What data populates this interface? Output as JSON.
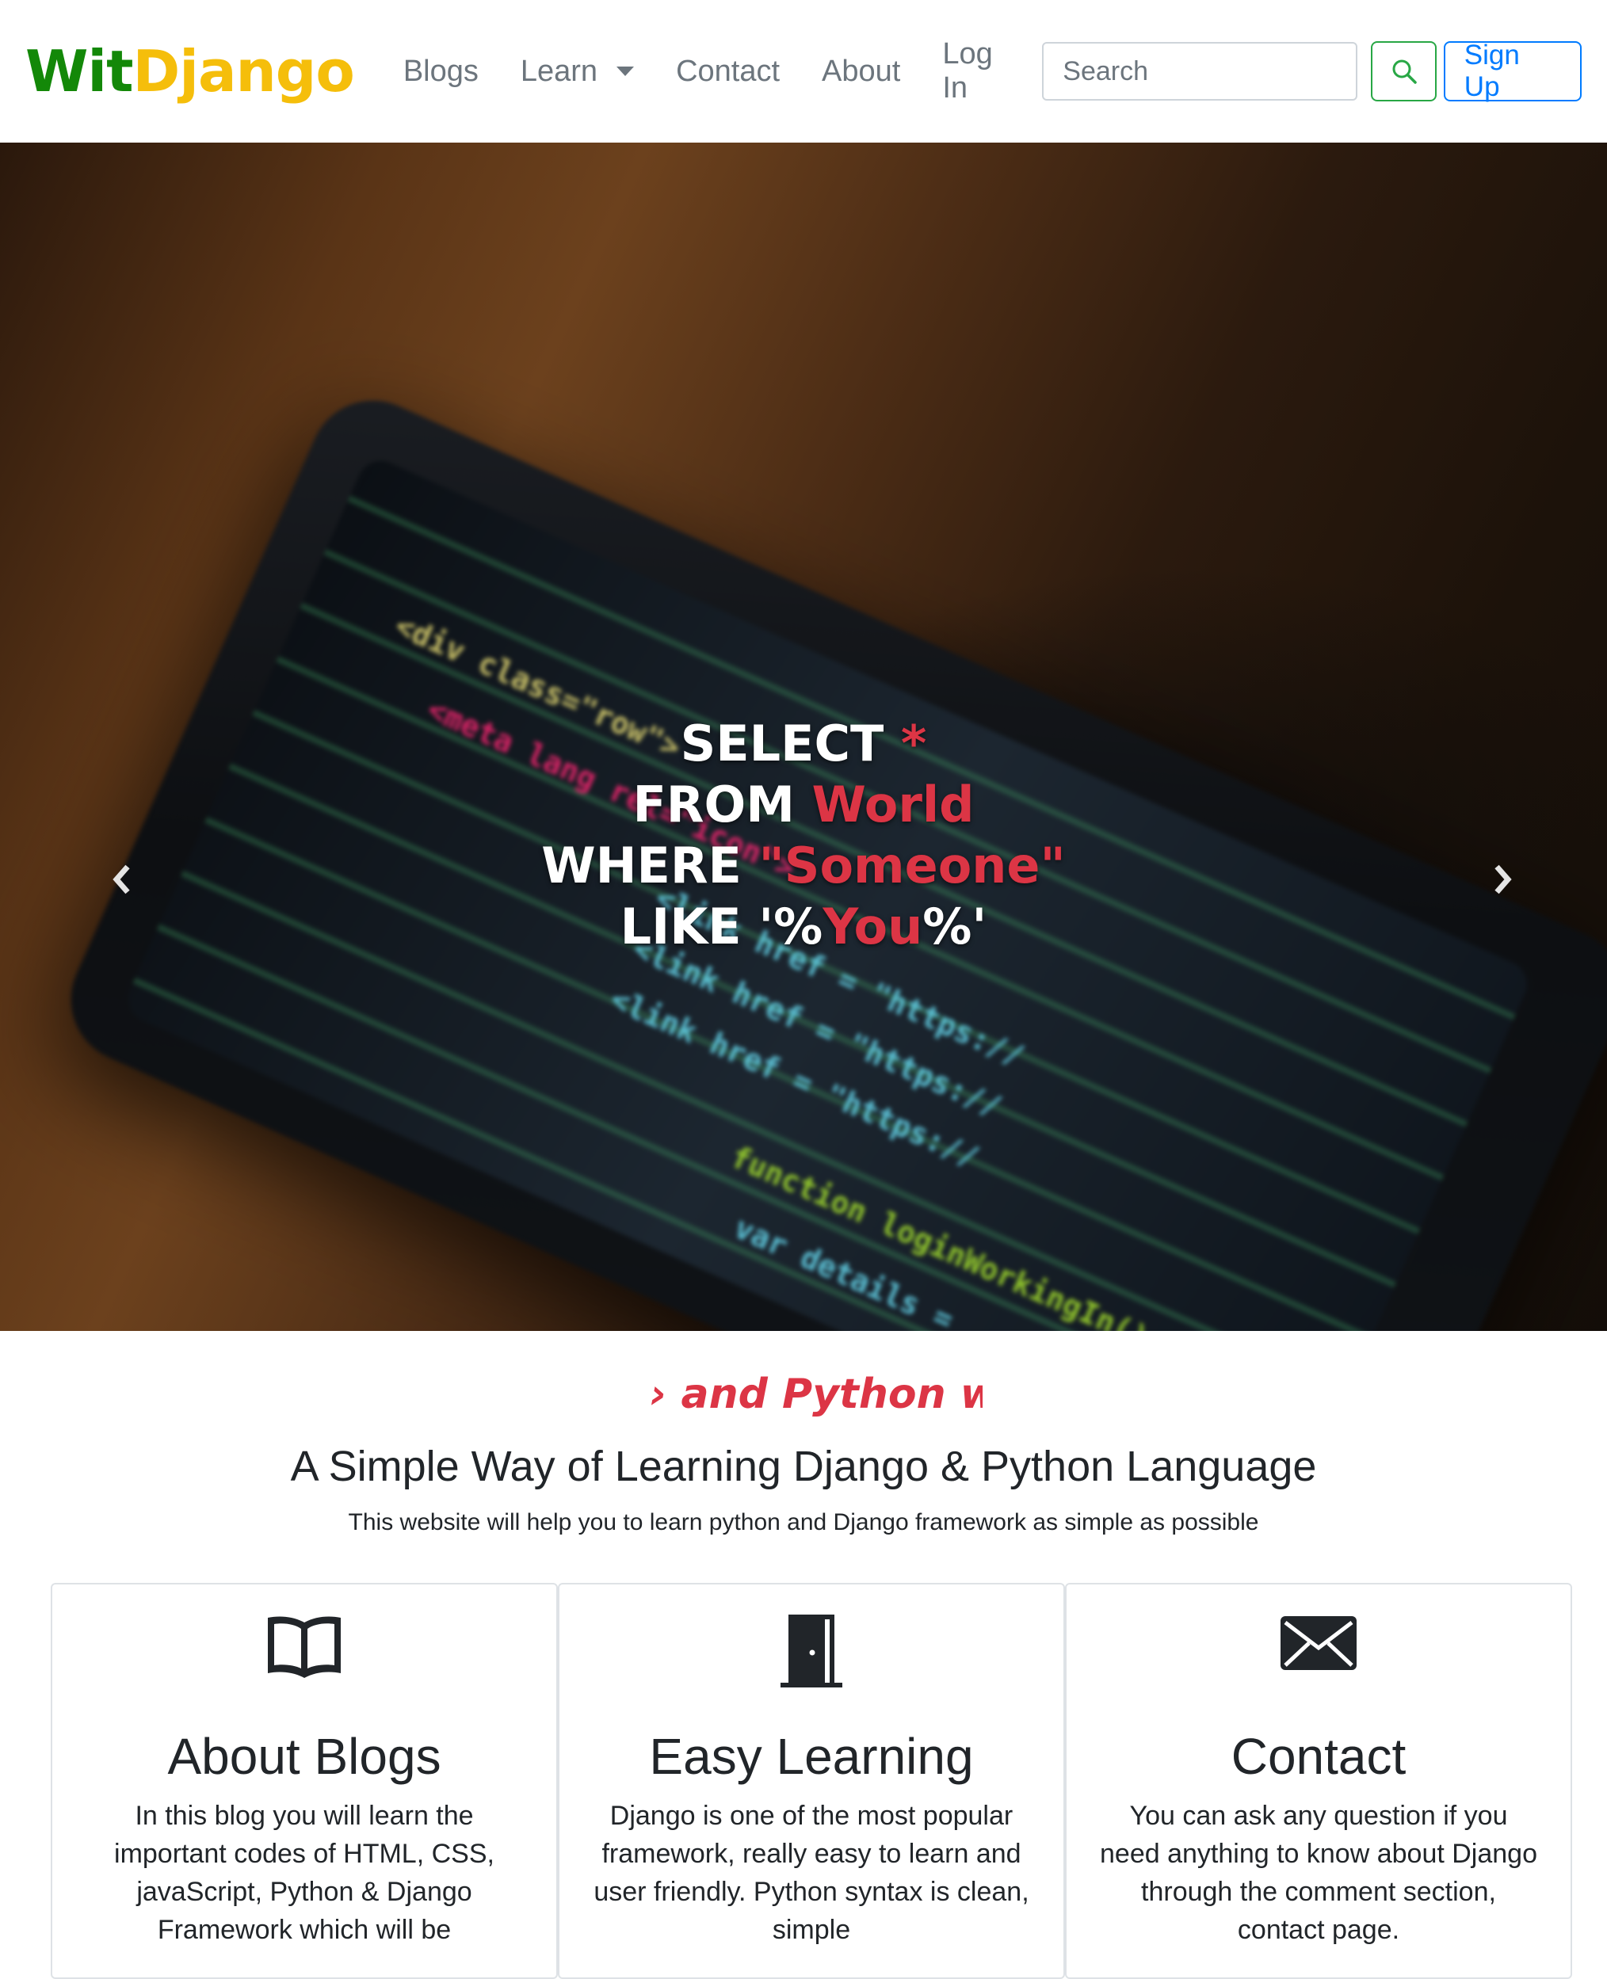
{
  "navbar": {
    "brand": {
      "part1": "Wit",
      "part2": "Django"
    },
    "links": [
      {
        "label": "Blogs"
      },
      {
        "label": "Learn"
      },
      {
        "label": "Contact"
      },
      {
        "label": "About"
      },
      {
        "label": "Log In"
      }
    ],
    "search": {
      "placeholder": "Search",
      "value": ""
    },
    "search_button_icon": "search-icon",
    "signup_label": "Sign Up"
  },
  "hero": {
    "lines": {
      "l1_a": "SELECT ",
      "l1_b": "*",
      "l2_a": "FROM ",
      "l2_b": "World",
      "l3_a": "WHERE ",
      "l3_b": "\"Someone\"",
      "l4_a": "LIKE '%",
      "l4_b": "You",
      "l4_c": "%'"
    },
    "indicators": 3,
    "active_indicator": 2,
    "prev_icon": "chevron-left-icon",
    "next_icon": "chevron-right-icon"
  },
  "intro": {
    "typed_text": "› and Python we",
    "title": "A Simple Way of Learning Django & Python Language",
    "subtitle": "This website will help you to learn python and Django framework as simple as possible"
  },
  "cards": [
    {
      "icon": "book-icon",
      "title": "About Blogs",
      "text": "In this blog you will learn the important codes of HTML, CSS, javaScript, Python & Django Framework which will be"
    },
    {
      "icon": "door-icon",
      "title": "Easy Learning",
      "text": "Django is one of the most popular framework, really easy to learn and user friendly. Python syntax is clean, simple"
    },
    {
      "icon": "envelope-icon",
      "title": "Contact",
      "text": "You can ask any question if you need anything to know about Django through the comment section, contact page."
    }
  ],
  "colors": {
    "brand_green": "#138808",
    "brand_yellow": "#f5be0b",
    "accent_red": "#dc3545",
    "search_green": "#28a745",
    "signup_blue": "#007bff"
  }
}
